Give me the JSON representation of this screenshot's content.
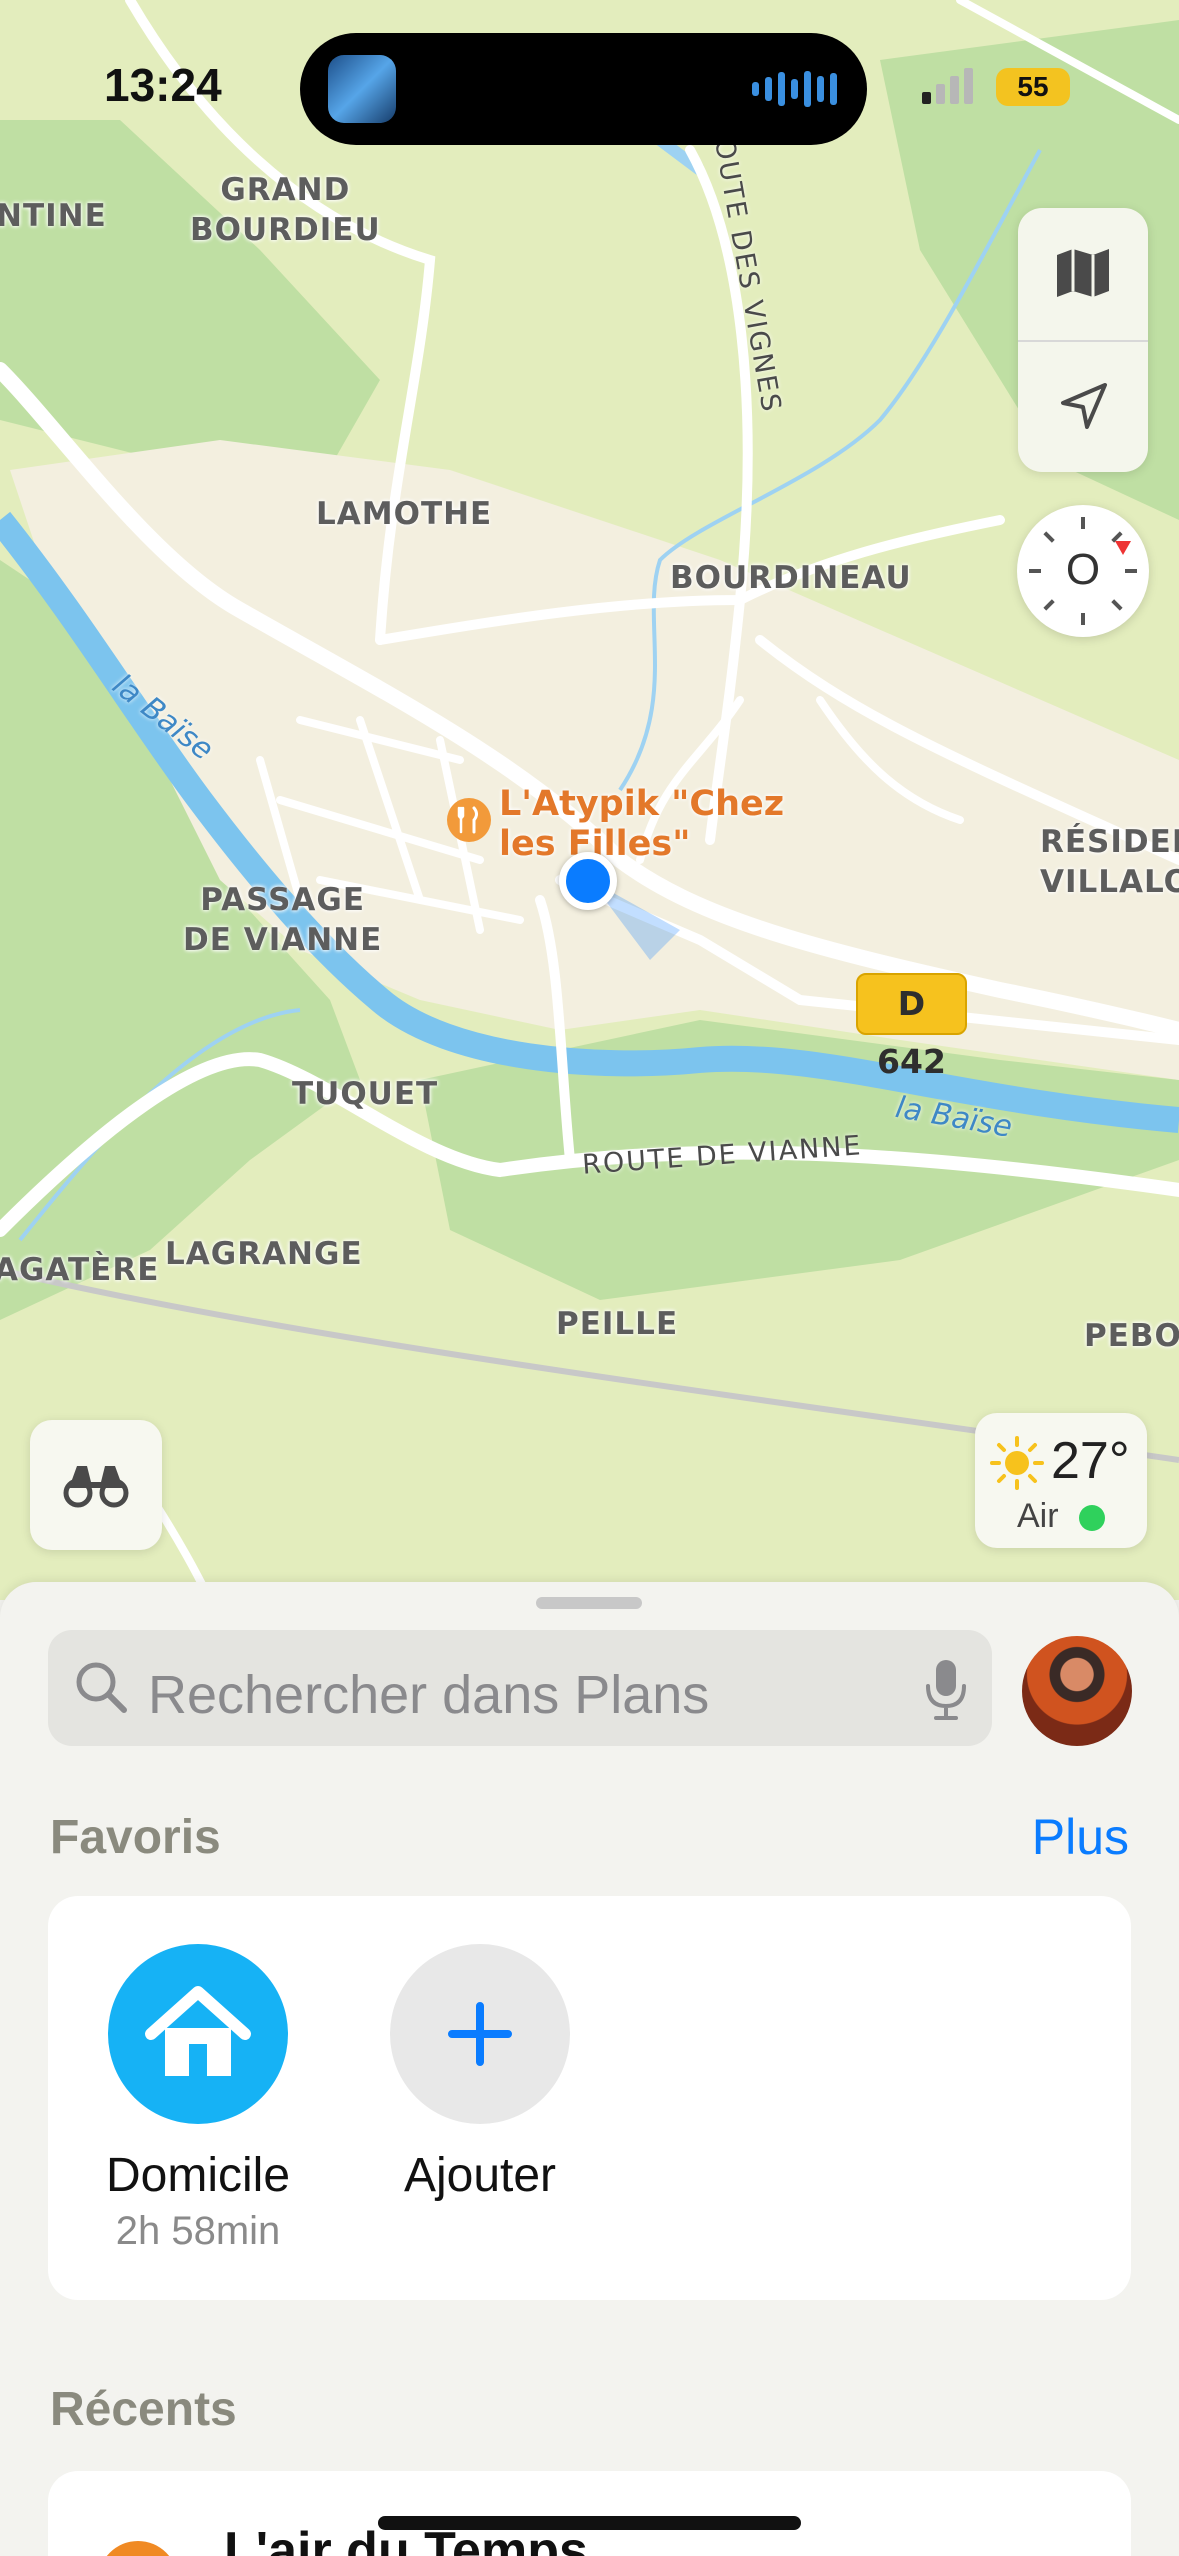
{
  "status": {
    "time": "13:24",
    "battery": "55"
  },
  "map": {
    "places": [
      "GRAND\nBOURDIEU",
      "LAMOTHE",
      "BOURDINEAU",
      "PASSAGE\nDE VIANNE",
      "TUQUET",
      "LAGRANGE",
      "PEILLE",
      "RÉSIDEN\nVILLALO",
      "NTINE",
      "AGATÈRE",
      "PEBO"
    ],
    "rivers": [
      "la Baïse",
      "la Baïse"
    ],
    "roads": [
      "ROUTE DE VIANNE",
      "ROUTE DES VIGNES"
    ],
    "road_badge": "D 642",
    "poi": {
      "name": "L'Atypik \"Chez\nles Filles\"",
      "icon": "fork-knife-icon"
    },
    "compass_letter": "O",
    "weather": {
      "temp": "27°",
      "air": "Air",
      "air_quality_color": "#2fd15c"
    }
  },
  "sheet": {
    "search_placeholder": "Rechercher dans Plans",
    "favorites_title": "Favoris",
    "more_label": "Plus",
    "favorites": [
      {
        "name": "Domicile",
        "subtitle": "2h 58min",
        "icon": "house-icon",
        "color": "#16b2f5"
      },
      {
        "name": "Ajouter",
        "icon": "plus-icon",
        "color": "#e8e8e8"
      }
    ],
    "recents_title": "Récents",
    "recents": [
      {
        "title": "L'air du Temps"
      }
    ]
  },
  "colors": {
    "accent": "#0a7cff",
    "poi": "#e3782a",
    "water": "#7cc4ee"
  }
}
